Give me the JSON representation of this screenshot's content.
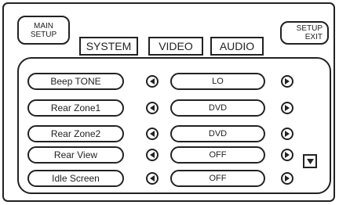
{
  "header": {
    "main_setup": [
      "MAIN",
      "SETUP"
    ],
    "setup_exit": [
      "SETUP",
      "EXIT"
    ]
  },
  "tabs": [
    {
      "label": "SYSTEM"
    },
    {
      "label": "VIDEO"
    },
    {
      "label": "AUDIO"
    }
  ],
  "settings": [
    {
      "label": "Beep TONE",
      "value": "LO"
    },
    {
      "label": "Rear Zone1",
      "value": "DVD"
    },
    {
      "label": "Rear Zone2",
      "value": "DVD"
    },
    {
      "label": "Rear View",
      "value": "OFF"
    },
    {
      "label": "Idle Screen",
      "value": "OFF"
    }
  ],
  "icons": {
    "prev": "left-triangle-icon",
    "next": "right-triangle-icon",
    "scroll": "down-triangle-icon"
  }
}
